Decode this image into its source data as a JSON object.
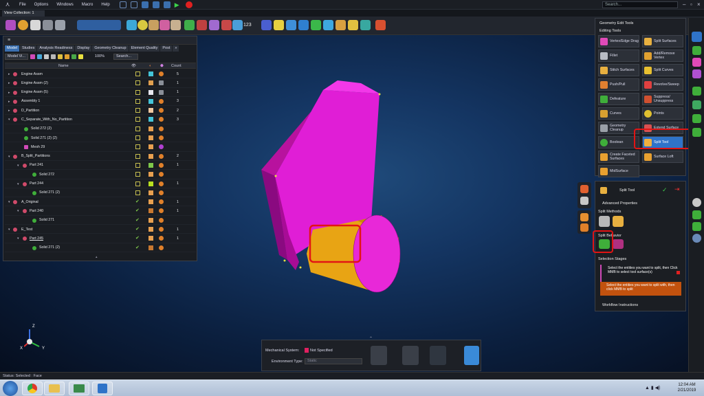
{
  "menubar": {
    "items": [
      "File",
      "Options",
      "Windows",
      "Macro",
      "Help"
    ],
    "search_placeholder": "Search..."
  },
  "tab": {
    "label": "View Collection: 1"
  },
  "toolbar": {
    "counter": "123"
  },
  "model_panel": {
    "tabs": [
      "Model",
      "Studies",
      "Analysis Readiness",
      "Display",
      "Geometry Cleanup",
      "Element Quality",
      "Post"
    ],
    "tabs_more": "»",
    "view_select": "Model Vi...",
    "zoom": "100%",
    "search_button": "Search...",
    "col_name": "Name",
    "col_count": "Count",
    "rows": [
      {
        "name": "Engine Assm",
        "count": "5"
      },
      {
        "name": "Engine Assm (2)",
        "count": "1"
      },
      {
        "name": "Engine Assm (5)",
        "count": "1"
      },
      {
        "name": "Assembly 1",
        "count": "3"
      },
      {
        "name": "D_Partition",
        "count": "2"
      },
      {
        "name": "C_Separate_With_No_Partition",
        "count": "3"
      },
      {
        "name": "Solid 272 (2)",
        "count": ""
      },
      {
        "name": "Solid 271 (2) (2)",
        "count": ""
      },
      {
        "name": "Mesh 29",
        "count": ""
      },
      {
        "name": "B_Split_Partitions",
        "count": "2"
      },
      {
        "name": "Part 241",
        "count": "1"
      },
      {
        "name": "Solid 272",
        "count": ""
      },
      {
        "name": "Part 244",
        "count": "1"
      },
      {
        "name": "Solid 271 (2)",
        "count": ""
      },
      {
        "name": "A_Original",
        "count": "1"
      },
      {
        "name": "Part 240",
        "count": "1"
      },
      {
        "name": "Solid 271",
        "count": ""
      },
      {
        "name": "E_Test",
        "count": "1"
      },
      {
        "name": "Part 245",
        "count": "1"
      },
      {
        "name": "Solid 271 (2)",
        "count": ""
      }
    ]
  },
  "geometry_panel": {
    "title": "Geometry Edit Tools",
    "subtitle": "Editing Tools",
    "buttons": [
      "Vertex/Edge Drag",
      "Split Surfaces",
      "Fillet",
      "Add/Remove Vertex",
      "Stitch Surfaces",
      "Split Curves",
      "Push/Pull",
      "Revolve/Sweep",
      "Defeature",
      "Suppress/ Unsuppress",
      "Curves",
      "Points",
      "Geometry Cleanup",
      "Extend Surface",
      "Boolean",
      "Split Tool",
      "Create Faceted Surfaces",
      "Surface Loft",
      "MidSurface"
    ]
  },
  "split_panel": {
    "title": "Split Tool",
    "advanced": "Advanced Properties",
    "methods": "Split Methods",
    "behavior": "Split Behavior",
    "stages_title": "Selection Stages",
    "stage1": "Select the entities you want to split, then Click MMB to select tool surface(s)",
    "stage2": "Select the entities you want to split with, then click MMB to split",
    "workflow": "Workflow Instructions"
  },
  "bottom_panel": {
    "mech_label": "Mechanical System:",
    "mech_value": "Not Specified",
    "env_label": "Environment Type:",
    "env_value": "Static"
  },
  "triad": {
    "z": "Z",
    "x": "X",
    "y": "Y"
  },
  "status": {
    "text": "Status:  Selected : Face"
  },
  "clock": {
    "time": "12:04 AM",
    "date": "2/21/2019"
  }
}
